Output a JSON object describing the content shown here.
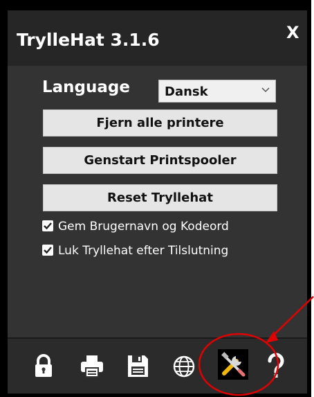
{
  "app": {
    "title": "TrylleHat 3.1.6",
    "close_label": "X"
  },
  "language": {
    "label": "Language",
    "selected": "Dansk"
  },
  "buttons": {
    "remove_printers": "Fjern alle printere",
    "restart_spooler": "Genstart Printspooler",
    "reset": "Reset Tryllehat"
  },
  "options": {
    "save_credentials": {
      "label": "Gem Brugernavn og Kodeord",
      "checked": true
    },
    "close_after_connect": {
      "label": "Luk Tryllehat efter Tilslutning",
      "checked": true
    }
  },
  "toolbar": {
    "icons": [
      "lock-icon",
      "printer-icon",
      "save-icon",
      "globe-icon",
      "tools-icon",
      "help-icon"
    ],
    "active": "tools-icon"
  },
  "colors": {
    "panel": "#333333",
    "titlebar": "#262626",
    "button": "#e5e5e5",
    "annotation": "#e00000",
    "tools_accent": "#f2b705"
  }
}
